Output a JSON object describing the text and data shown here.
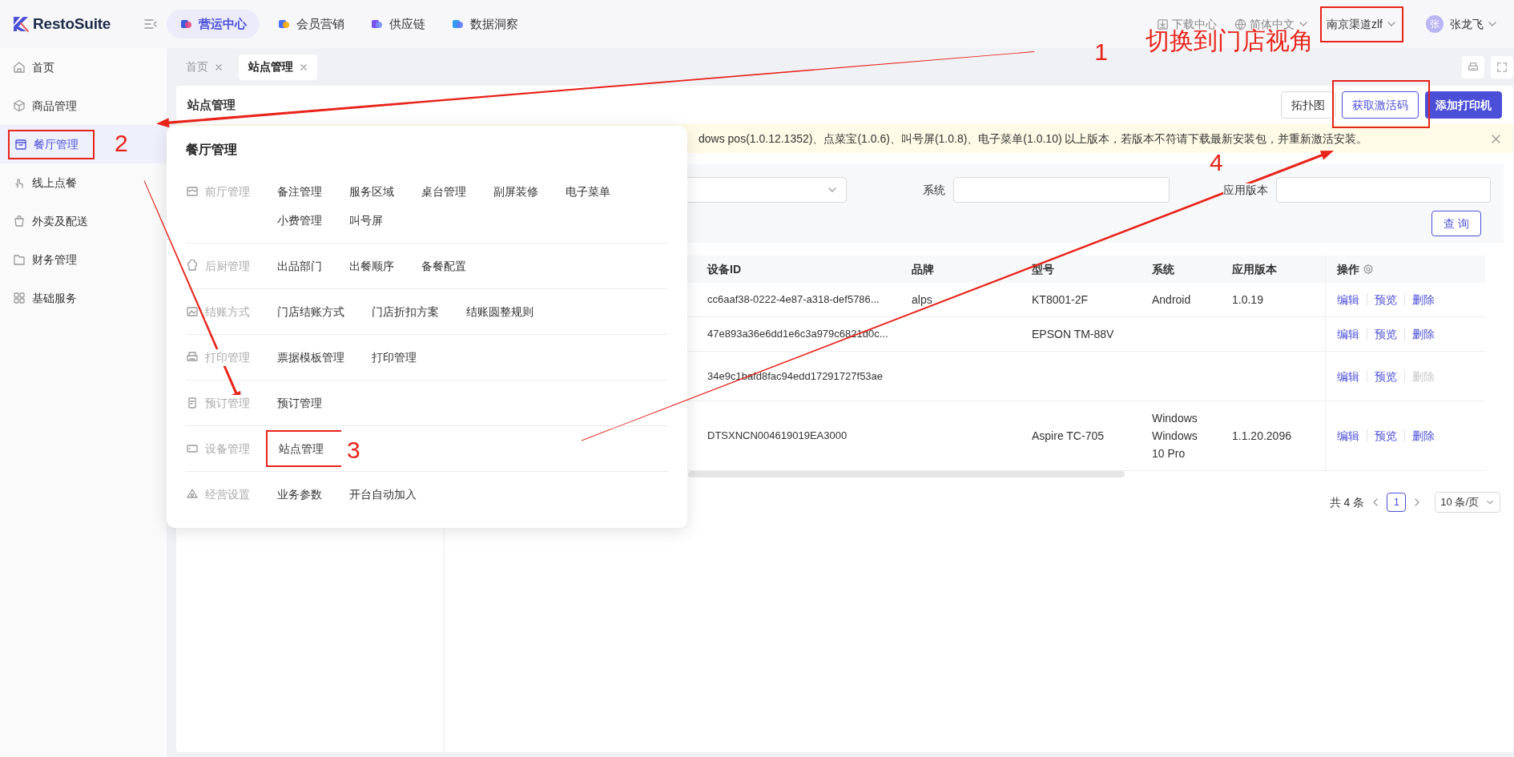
{
  "topbar": {
    "logo": "RestoSuite",
    "modules": [
      {
        "label": "营运中心",
        "selected": true
      },
      {
        "label": "会员营销",
        "selected": false
      },
      {
        "label": "供应链",
        "selected": false
      },
      {
        "label": "数据洞察",
        "selected": false
      }
    ],
    "download": "下载中心",
    "language": "简体中文",
    "store": {
      "label": "南京渠道zlf",
      "callout": {
        "number": "1",
        "note": "切换到门店视角"
      }
    },
    "user": {
      "avatar": "张",
      "name": "张龙飞"
    }
  },
  "sidebar": {
    "items": [
      {
        "label": "首页",
        "selected": false
      },
      {
        "label": "商品管理",
        "selected": false
      },
      {
        "label": "餐厅管理",
        "selected": true,
        "callout": {
          "number": "2"
        }
      },
      {
        "label": "线上点餐",
        "selected": false
      },
      {
        "label": "外卖及配送",
        "selected": false
      },
      {
        "label": "财务管理",
        "selected": false
      },
      {
        "label": "基础服务",
        "selected": false
      }
    ]
  },
  "page_tabs": [
    {
      "label": "首页",
      "selected": false
    },
    {
      "label": "站点管理",
      "selected": true
    }
  ],
  "menu": {
    "title": "餐厅管理",
    "groups": [
      {
        "label": "前厅管理",
        "items": [
          {
            "label": "备注管理"
          },
          {
            "label": "服务区域"
          },
          {
            "label": "桌台管理"
          },
          {
            "label": "副屏装修"
          },
          {
            "label": "电子菜单"
          },
          {
            "label": "小费管理"
          },
          {
            "label": "叫号屏"
          }
        ]
      },
      {
        "label": "后厨管理",
        "items": [
          {
            "label": "出品部门"
          },
          {
            "label": "出餐顺序"
          },
          {
            "label": "备餐配置"
          }
        ]
      },
      {
        "label": "结账方式",
        "items": [
          {
            "label": "门店结账方式"
          },
          {
            "label": "门店折扣方案"
          },
          {
            "label": "结账圆整规则"
          }
        ]
      },
      {
        "label": "打印管理",
        "items": [
          {
            "label": "票据模板管理"
          },
          {
            "label": "打印管理"
          }
        ]
      },
      {
        "label": "预订管理",
        "items": [
          {
            "label": "预订管理"
          }
        ]
      },
      {
        "label": "设备管理",
        "items": [
          {
            "label": "站点管理",
            "callout": {
              "number": "3"
            }
          }
        ]
      },
      {
        "label": "经营设置",
        "items": [
          {
            "label": "业务参数"
          },
          {
            "label": "开台自动加入"
          }
        ]
      }
    ]
  },
  "page": {
    "title": "站点管理",
    "buttons": [
      {
        "label": "拓扑图",
        "kind": "outline"
      },
      {
        "label": "获取激活码",
        "kind": "accent",
        "callout": {
          "number": "4"
        }
      },
      {
        "label": "添加打印机",
        "kind": "primary"
      }
    ],
    "notice": "dows pos(1.0.12.1352)、点菜宝(1.0.6)、叫号屏(1.0.8)、电子菜单(1.0.10) 以上版本，若版本不符请下载最新安装包，并重新激活安装。",
    "filters": [
      {
        "kind": "select"
      },
      {
        "kind": "input",
        "label": "系统"
      },
      {
        "kind": "input",
        "label": "应用版本"
      }
    ],
    "query_button": "查 询",
    "table": {
      "columns": [
        "设备ID",
        "品牌",
        "型号",
        "系统",
        "应用版本",
        "操作"
      ],
      "rows": [
        {
          "cells": [
            "cc6aaf38-0222-4e87-a318-def5786...",
            "alps",
            "KT8001-2F",
            "Android",
            "1.0.19"
          ],
          "actions": [
            {
              "label": "编辑",
              "disabled": false
            },
            {
              "label": "预览",
              "disabled": false
            },
            {
              "label": "删除",
              "disabled": false
            }
          ]
        },
        {
          "cells": [
            "47e893a36e6dd1e6c3a979c6821d0c...",
            "",
            "EPSON TM-88V",
            "",
            ""
          ],
          "actions": [
            {
              "label": "编辑",
              "disabled": false
            },
            {
              "label": "预览",
              "disabled": false
            },
            {
              "label": "删除",
              "disabled": false
            }
          ]
        },
        {
          "cells": [
            "34e9c1bafd8fac94edd17291727f53ae",
            "",
            "",
            "",
            ""
          ],
          "actions": [
            {
              "label": "编辑",
              "disabled": false
            },
            {
              "label": "预览",
              "disabled": false
            },
            {
              "label": "删除",
              "disabled": true
            }
          ]
        },
        {
          "cells": [
            "DTSXNCN004619019EA3000",
            "",
            "Aspire TC-705",
            "Windows Windows 10 Pro",
            "1.1.20.2096"
          ],
          "actions": [
            {
              "label": "编辑",
              "disabled": false
            },
            {
              "label": "预览",
              "disabled": false
            },
            {
              "label": "删除",
              "disabled": false
            }
          ]
        }
      ]
    },
    "pagination": {
      "total": "共 4 条",
      "page": "1",
      "page_size": "10 条/页"
    }
  }
}
